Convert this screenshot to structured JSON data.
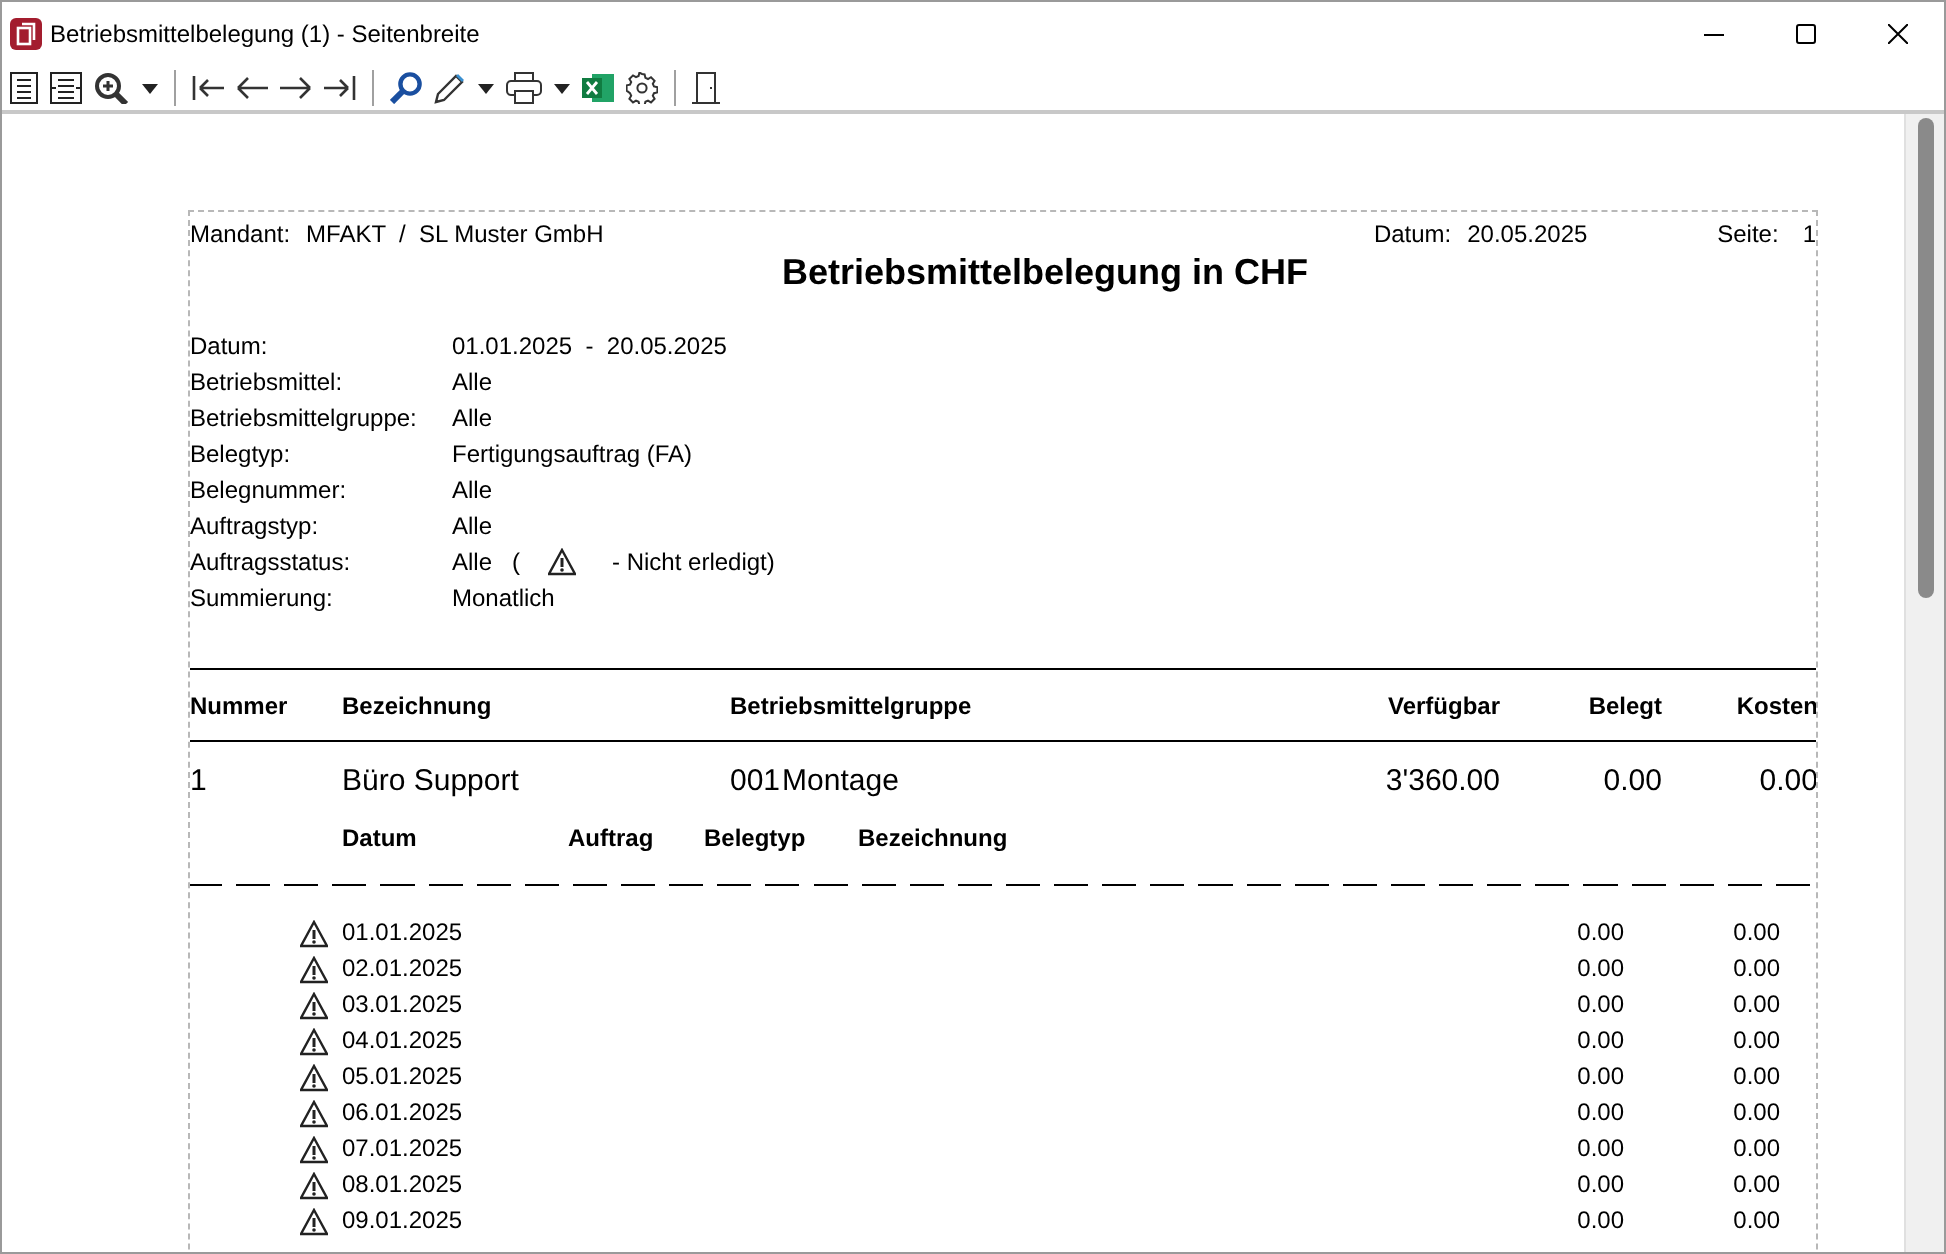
{
  "window": {
    "title": "Betriebsmittelbelegung (1) - Seitenbreite"
  },
  "report": {
    "header": {
      "mandant_label": "Mandant:",
      "mandant": "MFAKT  /  SL Muster GmbH",
      "date_label": "Datum:",
      "date": "20.05.2025",
      "page_label": "Seite:",
      "page": "1"
    },
    "title": "Betriebsmittelbelegung in CHF",
    "filters": [
      {
        "kind": "plain",
        "label": "Datum:",
        "value": "01.01.2025  -  20.05.2025"
      },
      {
        "kind": "plain",
        "label": "Betriebsmittel:",
        "value": "Alle"
      },
      {
        "kind": "plain",
        "label": "Betriebsmittelgruppe:",
        "value": "Alle"
      },
      {
        "kind": "plain",
        "label": "Belegtyp:",
        "value": "Fertigungsauftrag (FA)"
      },
      {
        "kind": "plain",
        "label": "Belegnummer:",
        "value": "Alle"
      },
      {
        "kind": "plain",
        "label": "Auftragstyp:",
        "value": "Alle"
      },
      {
        "kind": "status",
        "label": "Auftragsstatus:",
        "value": "Alle   (",
        "note": "- Nicht erledigt)"
      },
      {
        "kind": "plain",
        "label": "Summierung:",
        "value": "Monatlich"
      }
    ],
    "columns": [
      "Nummer",
      "Bezeichnung",
      "Betriebsmittelgruppe",
      "Verfügbar",
      "Belegt",
      "Kosten"
    ],
    "rows": [
      {
        "number": "1",
        "name": "Büro Support",
        "group_code": "001",
        "group_name": "Montage",
        "available": "3'360.00",
        "booked": "0.00",
        "costs": "0.00"
      }
    ],
    "sub_columns": [
      "Datum",
      "Auftrag",
      "Belegtyp",
      "Bezeichnung"
    ],
    "details": [
      {
        "warning": true,
        "date": "01.01.2025",
        "booked": "0.00",
        "costs": "0.00"
      },
      {
        "warning": true,
        "date": "02.01.2025",
        "booked": "0.00",
        "costs": "0.00"
      },
      {
        "warning": true,
        "date": "03.01.2025",
        "booked": "0.00",
        "costs": "0.00"
      },
      {
        "warning": true,
        "date": "04.01.2025",
        "booked": "0.00",
        "costs": "0.00"
      },
      {
        "warning": true,
        "date": "05.01.2025",
        "booked": "0.00",
        "costs": "0.00"
      },
      {
        "warning": true,
        "date": "06.01.2025",
        "booked": "0.00",
        "costs": "0.00"
      },
      {
        "warning": true,
        "date": "07.01.2025",
        "booked": "0.00",
        "costs": "0.00"
      },
      {
        "warning": true,
        "date": "08.01.2025",
        "booked": "0.00",
        "costs": "0.00"
      },
      {
        "warning": true,
        "date": "09.01.2025",
        "booked": "0.00",
        "costs": "0.00"
      }
    ]
  }
}
